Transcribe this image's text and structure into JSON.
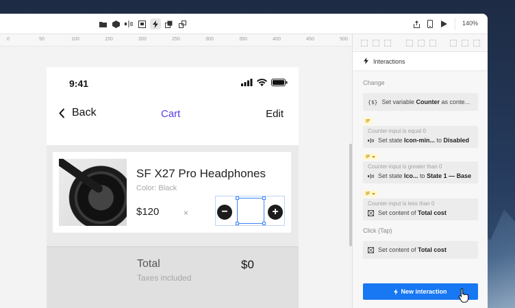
{
  "toolbar": {
    "icons": [
      "folder-icon",
      "component-icon",
      "split-icon",
      "frame-icon",
      "interaction-icon",
      "layers-icon",
      "copy-icon"
    ],
    "right_icons": [
      "share-icon",
      "phone-icon",
      "play-icon"
    ],
    "zoom": "140%"
  },
  "ruler": {
    "ticks": [
      "0",
      "50",
      "100",
      "150",
      "200",
      "250",
      "300",
      "350",
      "400",
      "450",
      "500"
    ]
  },
  "phone": {
    "time": "9:41",
    "nav": {
      "back_label": "Back",
      "title": "Cart",
      "edit_label": "Edit"
    },
    "product": {
      "name": "SF X27 Pro Headphones",
      "color": "Color: Black",
      "price": "$120",
      "times": "×",
      "minus": "−",
      "plus": "+"
    },
    "total": {
      "label": "Total",
      "taxes": "Taxes included",
      "value": "$0"
    }
  },
  "panel": {
    "tab_label": "Interactions",
    "sections": {
      "change": "Change",
      "click": "Click (Tap)"
    },
    "change_items": [
      {
        "icon": "variable-icon",
        "text_pre": "Set variable ",
        "text_bold": "Counter",
        "text_post": " as conte..."
      },
      {
        "tag": "IF",
        "condition": "Counter-input is equal 0",
        "icon": "state-icon",
        "text_pre": "Set state ",
        "text_bold": "Icon-min...",
        "text_mid": " to ",
        "text_bold2": "Disabled"
      },
      {
        "tag": "IF",
        "condition": "Counter-input is greater than 0",
        "icon": "state-icon",
        "text_pre": "Set state ",
        "text_bold": "Ico...",
        "text_mid": " to ",
        "text_bold2": "State 1 — Base"
      },
      {
        "tag": "IF",
        "condition": "Counter-input is less than 0",
        "icon": "content-icon",
        "text_pre": "Set content of ",
        "text_bold": "Total cost"
      }
    ],
    "click_item": {
      "icon": "content-icon",
      "text_pre": "Set content of ",
      "text_bold": "Total cost"
    },
    "new_interaction": "New interaction",
    "accent": "#1877f2"
  }
}
